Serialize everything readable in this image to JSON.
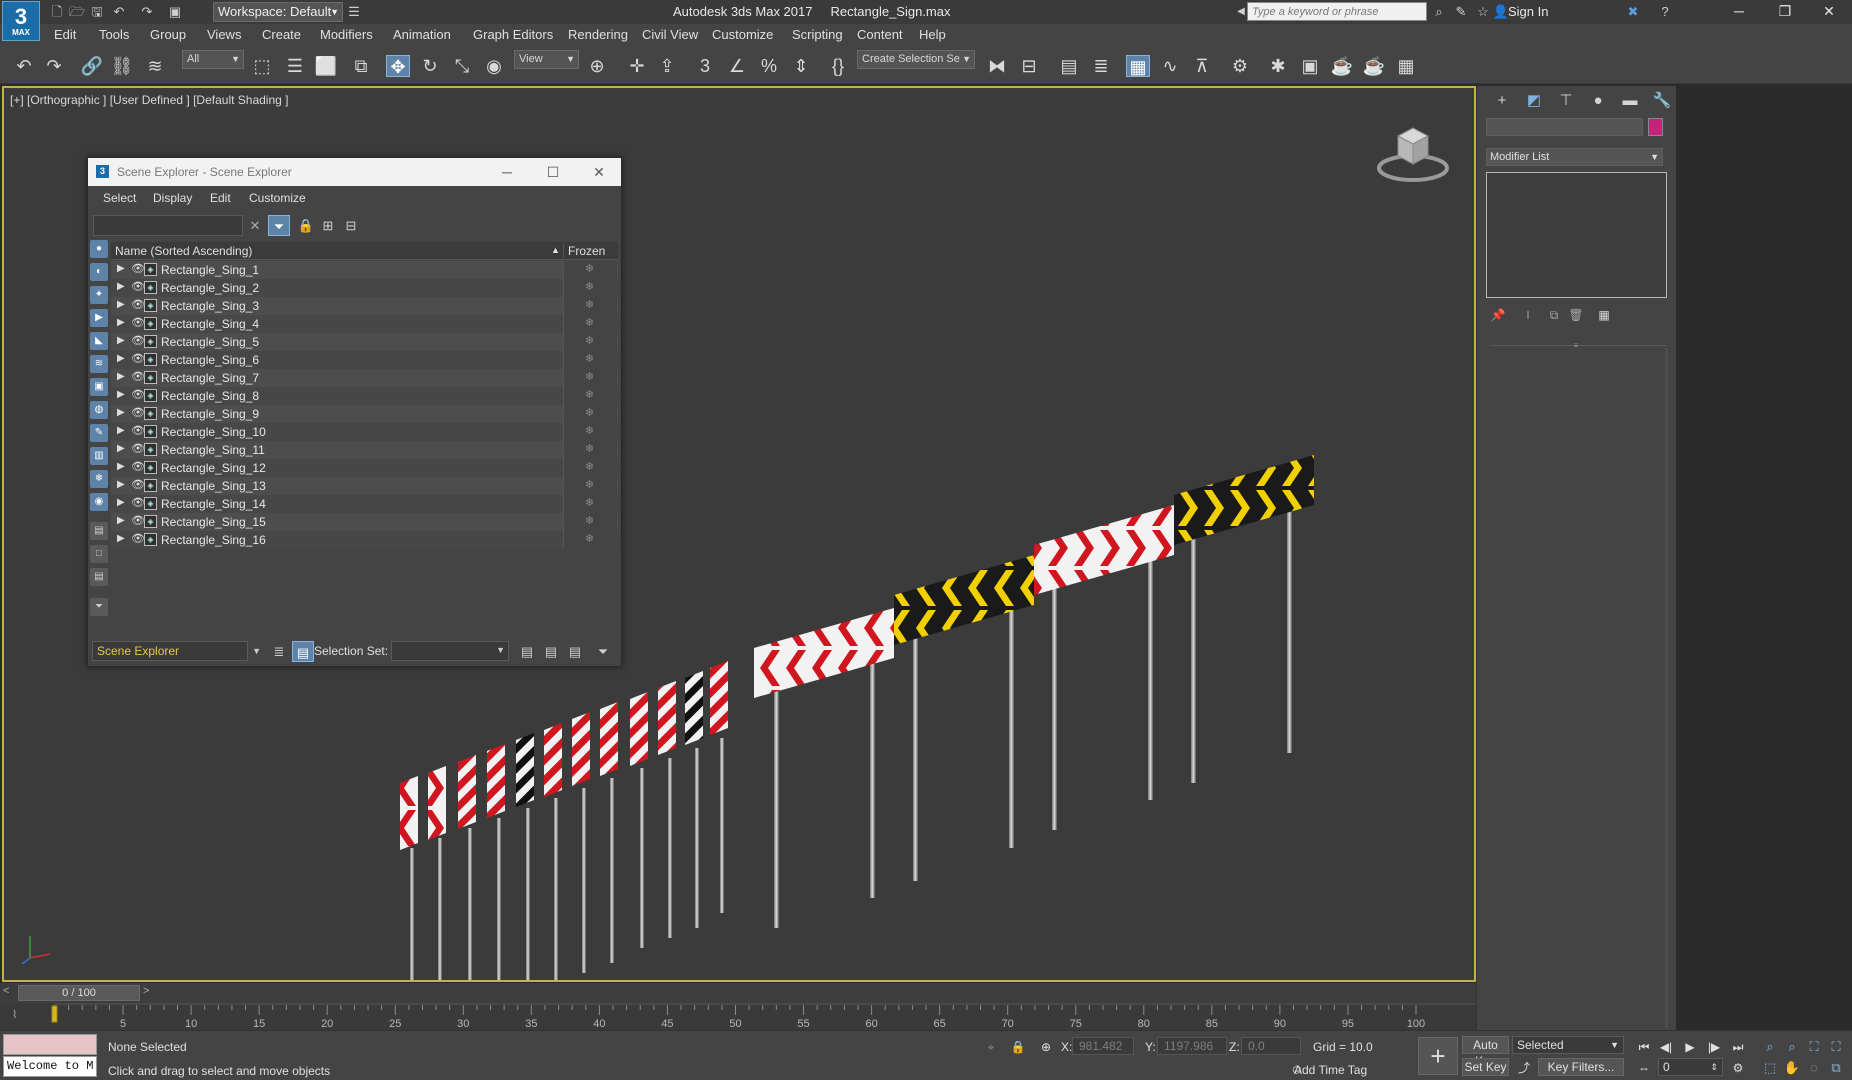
{
  "app": {
    "logo_text": "3",
    "logo_sub": "MAX",
    "workspace_label": "Workspace: Default",
    "window_title": "Autodesk 3ds Max 2017     Rectangle_Sign.max",
    "search_placeholder": "Type a keyword or phrase",
    "signin_label": "Sign In"
  },
  "menu": [
    "Edit",
    "Tools",
    "Group",
    "Views",
    "Create",
    "Modifiers",
    "Animation",
    "Graph Editors",
    "Rendering",
    "Civil View",
    "Customize",
    "Scripting",
    "Content",
    "Help"
  ],
  "toolbar": {
    "filter_value": "All",
    "refcoord_value": "View",
    "selection_set_value": "Create Selection Se"
  },
  "viewport": {
    "label": "[+] [Orthographic ] [User Defined ] [Default Shading ]"
  },
  "scene_explorer": {
    "title": "Scene Explorer - Scene Explorer",
    "menu": [
      "Select",
      "Display",
      "Edit",
      "Customize"
    ],
    "col_name": "Name (Sorted Ascending)",
    "col_frozen": "Frozen",
    "objects": [
      "Rectangle_Sing_1",
      "Rectangle_Sing_2",
      "Rectangle_Sing_3",
      "Rectangle_Sing_4",
      "Rectangle_Sing_5",
      "Rectangle_Sing_6",
      "Rectangle_Sing_7",
      "Rectangle_Sing_8",
      "Rectangle_Sing_9",
      "Rectangle_Sing_10",
      "Rectangle_Sing_11",
      "Rectangle_Sing_12",
      "Rectangle_Sing_13",
      "Rectangle_Sing_14",
      "Rectangle_Sing_15",
      "Rectangle_Sing_16"
    ],
    "footer_explorer": "Scene Explorer",
    "footer_selset_label": "Selection Set:"
  },
  "command_panel": {
    "modifier_list": "Modifier List",
    "object_color": "#c2247c"
  },
  "timeline": {
    "frame_readout": "0 / 100",
    "ticks": [
      "5",
      "10",
      "15",
      "20",
      "25",
      "30",
      "35",
      "40",
      "45",
      "50",
      "55",
      "60",
      "65",
      "70",
      "75",
      "80",
      "85",
      "90",
      "95",
      "100"
    ]
  },
  "status": {
    "maxscript_text": "Welcome to M",
    "selection": "None Selected",
    "prompt": "Click and drag to select and move objects",
    "x_label": "X:",
    "x_value": "981.482",
    "y_label": "Y:",
    "y_value": "1197.986",
    "z_label": "Z:",
    "z_value": "0.0",
    "grid": "Grid = 10.0",
    "add_time_tag": "Add Time Tag",
    "auto_key": "Auto Key",
    "set_key": "Set Key",
    "key_mode": "Selected",
    "key_filters": "Key Filters...",
    "current_frame": "0"
  },
  "colors": {
    "viewport_border": "#c5b34a",
    "accent_blue": "#5d84a8",
    "sign_red": "#d0161e",
    "sign_yellow": "#f2d000"
  }
}
